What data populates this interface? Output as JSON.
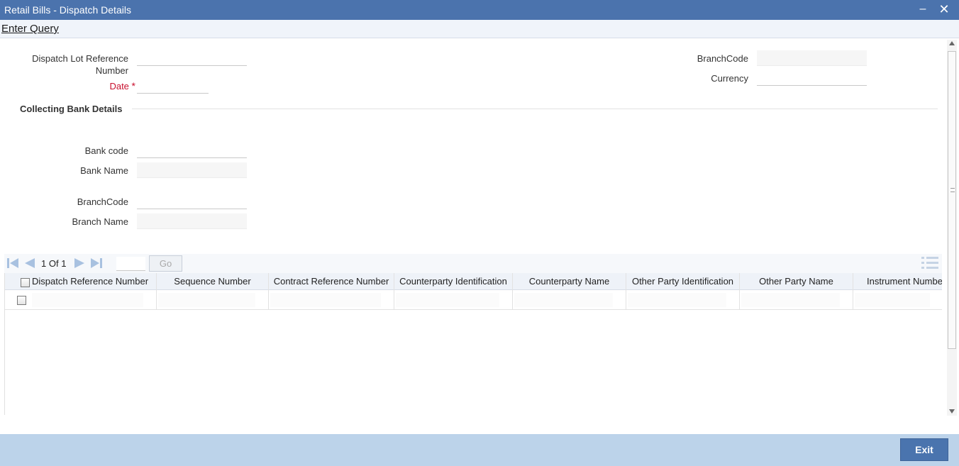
{
  "window": {
    "title": "Retail Bills - Dispatch Details",
    "minimize_glyph": "‒",
    "close_glyph": "✕"
  },
  "menu": {
    "enter_query": "Enter Query"
  },
  "form": {
    "dispatch_lot_ref_line1": "Dispatch Lot Reference",
    "dispatch_lot_ref_line2": "Number",
    "dispatch_lot_ref_value": "",
    "date_label": "Date",
    "date_required_mark": "*",
    "date_value": "",
    "branch_code_label": "BranchCode",
    "branch_code_value": "",
    "currency_label": "Currency",
    "currency_value": ""
  },
  "collecting_bank": {
    "section_title": "Collecting Bank Details",
    "bank_code_label": "Bank code",
    "bank_code_value": "",
    "bank_name_label": "Bank Name",
    "bank_name_value": "",
    "branch_code_label": "BranchCode",
    "branch_code_value": "",
    "branch_name_label": "Branch Name",
    "branch_name_value": ""
  },
  "pager": {
    "current_page": "1",
    "of_text": "Of",
    "total_pages": "1",
    "page_input_value": "",
    "go_label": "Go"
  },
  "grid": {
    "columns": [
      "Dispatch Reference Number",
      "Sequence Number",
      "Contract Reference Number",
      "Counterparty Identification",
      "Counterparty Name",
      "Other Party Identification",
      "Other Party Name",
      "Instrument Number"
    ]
  },
  "footer": {
    "exit_label": "Exit"
  },
  "colors": {
    "titlebar": "#4b73ad",
    "footer": "#bcd3ea",
    "button": "#4a74ae",
    "required": "#c8102e",
    "pager_icon": "#a8c1e0"
  },
  "icons": {
    "first_page": "first-page-icon",
    "prev_page": "prev-page-icon",
    "next_page": "next-page-icon",
    "last_page": "last-page-icon",
    "columns": "column-list-icon"
  }
}
